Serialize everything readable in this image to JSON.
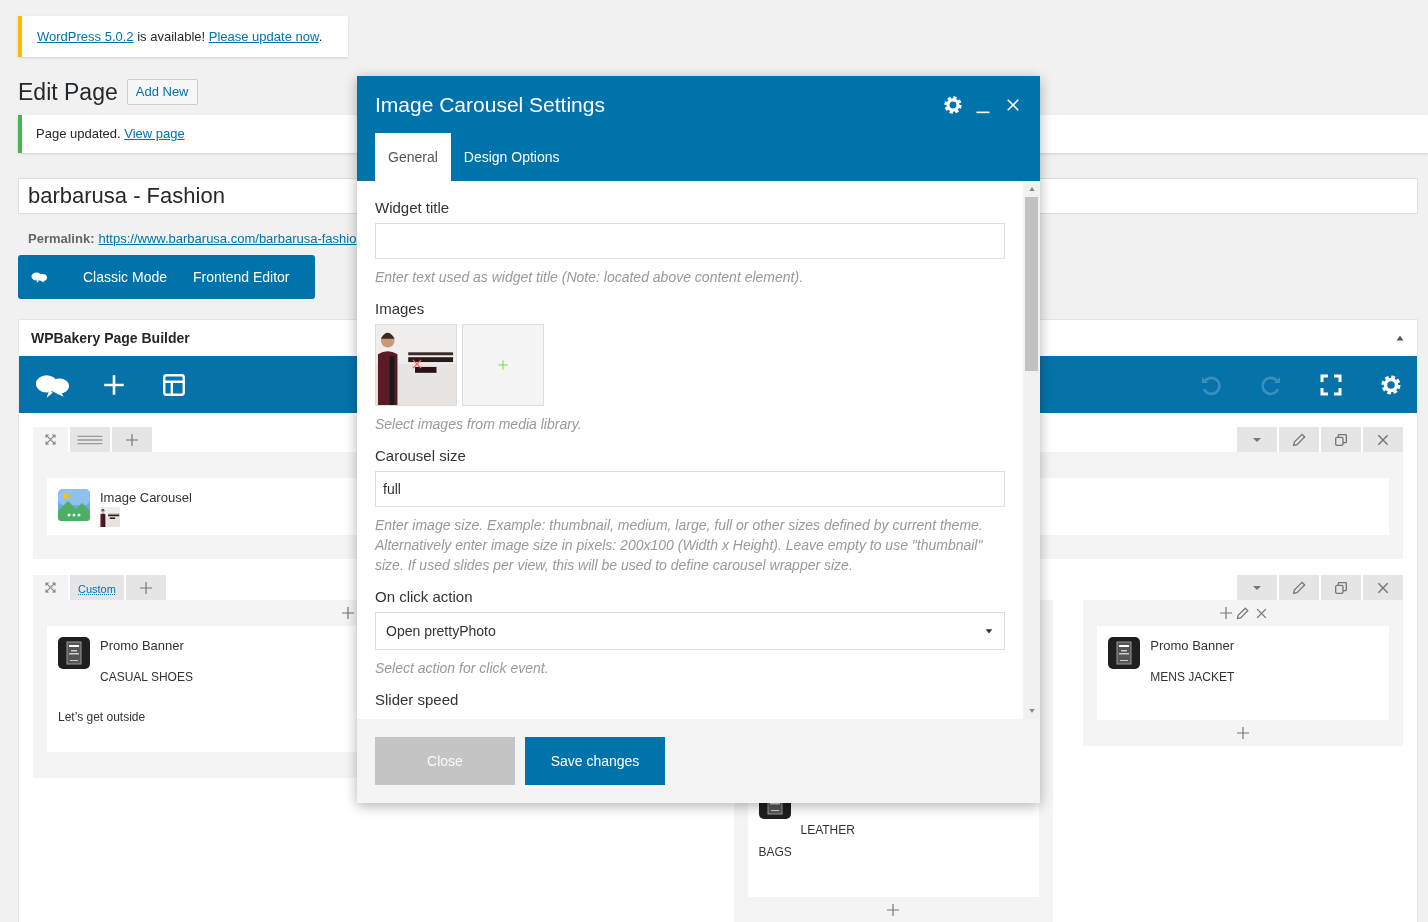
{
  "update_notice": {
    "parts": [
      {
        "text": "WordPress 5.0.2",
        "link": true
      },
      {
        "text": " is available! ",
        "link": false
      },
      {
        "text": "Please update now",
        "link": true
      },
      {
        "text": ".",
        "link": false
      }
    ]
  },
  "heading": "Edit Page",
  "add_new": "Add New",
  "updated_notice": {
    "text": "Page updated.",
    "link": "View page"
  },
  "title_field": {
    "value": "barbarusa - Fashion"
  },
  "permalink": {
    "label": "Permalink:",
    "url": "https://www.barbarusa.com/barbarusa-fashio"
  },
  "editor_modes": [
    "Classic Mode",
    "Frontend Editor"
  ],
  "builder": {
    "title": "WPBakery Page Builder",
    "tools": [
      {
        "kind": "undo",
        "disabled": true
      },
      {
        "kind": "redo",
        "disabled": true
      },
      {
        "kind": "fullscreen",
        "disabled": false
      },
      {
        "kind": "settings",
        "disabled": false
      }
    ],
    "rows": [
      {
        "columns": [
          {
            "elements": [
              {
                "kind": "carousel",
                "title": "Image Carousel"
              }
            ]
          }
        ]
      },
      {
        "layout_label": "Custom",
        "columns": [
          {
            "edit_controls": false,
            "bottom_add": false,
            "elements": [
              {
                "kind": "promo",
                "title": "Promo Banner",
                "subtitle": "CASUAL SHOES",
                "text": "Let’s get outside"
              }
            ]
          },
          {
            "bottom_add": true,
            "elements": [
              {
                "kind": "promo_lines",
                "lines": [
                  "LEATHER",
                  "BAGS"
                ]
              }
            ]
          },
          {
            "edit_controls": true,
            "bottom_add": true,
            "elements": [
              {
                "kind": "promo",
                "title": "Promo Banner",
                "subtitle": "MENS JACKET"
              }
            ]
          }
        ]
      }
    ]
  },
  "modal": {
    "title": "Image Carousel Settings",
    "tabs": [
      {
        "label": "General",
        "selected": true
      },
      {
        "label": "Design Options",
        "selected": false
      }
    ],
    "fields": [
      {
        "kind": "text",
        "label": "Widget title",
        "hint": "Enter text used as widget title (Note: located above content element)."
      },
      {
        "kind": "images",
        "label": "Images",
        "hint": "Select images from media library."
      },
      {
        "kind": "text",
        "label": "Carousel size",
        "value": "full",
        "hint": "Enter image size. Example: thumbnail, medium, large, full or other sizes defined by current theme. Alternatively enter image size in pixels: 200x100 (Width x Height). Leave empty to use \"thumbnail\" size. If used slides per view, this will be used to define carousel wrapper size."
      },
      {
        "kind": "select",
        "label": "On click action",
        "value": "Open prettyPhoto",
        "hint": "Select action for click event."
      },
      {
        "kind": "label",
        "label": "Slider speed"
      }
    ],
    "buttons": [
      {
        "label": "Close",
        "disabled": true
      },
      {
        "label": "Save changes",
        "disabled": false
      }
    ]
  }
}
